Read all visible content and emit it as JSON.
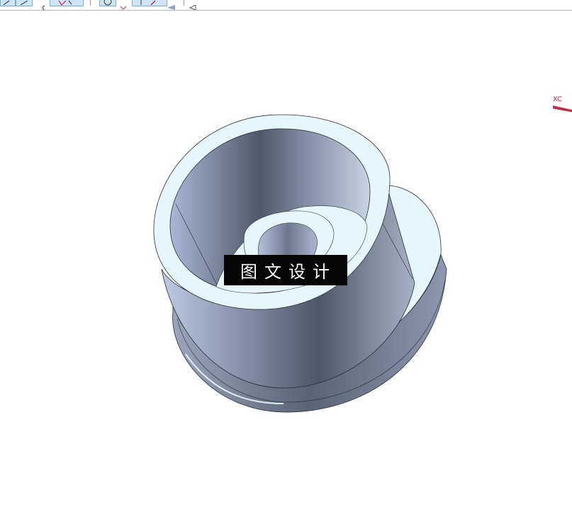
{
  "toolbar": {
    "buttons": [
      {
        "name": "line-icon"
      },
      {
        "name": "arc-icon"
      },
      {
        "name": "curve-icon"
      },
      {
        "name": "constraint-icon"
      },
      {
        "name": "circle-icon"
      },
      {
        "name": "solid-view-icon"
      },
      {
        "name": "point-icon"
      },
      {
        "name": "arrow-icon"
      },
      {
        "name": "triangle-icon"
      }
    ]
  },
  "viewport": {
    "axis_label": "XC",
    "watermark_text": "图文设计"
  },
  "colors": {
    "toolbar_highlight": "#cfe4f7",
    "axis": "#c0304a",
    "part_face_light": "#e6f7fc",
    "part_face_dark": "#4d5566",
    "watermark_bg": "#050505"
  }
}
